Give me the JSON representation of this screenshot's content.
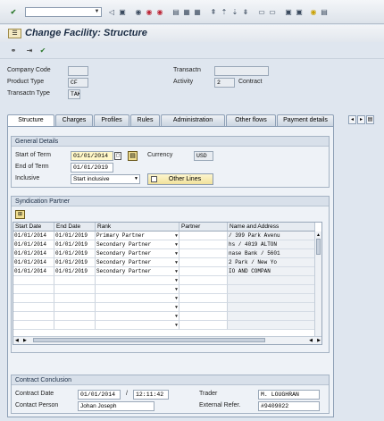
{
  "toolbar": {
    "enter_icon": "check-icon",
    "command_value": ""
  },
  "title": "Change Facility: Structure",
  "header": {
    "company_code_label": "Company Code",
    "company_code_value": "",
    "product_type_label": "Product Type",
    "product_type_value": "CF",
    "transactn_type_label": "Transactn Type",
    "transactn_type_value": "TAK",
    "transactn_label": "Transactn",
    "transactn_value": "",
    "activity_label": "Activity",
    "activity_value": "2",
    "activity_text": "Contract"
  },
  "tabs": [
    {
      "label": "Structure",
      "active": true
    },
    {
      "label": "Charges",
      "active": false
    },
    {
      "label": "Profiles",
      "active": false
    },
    {
      "label": "Rules",
      "active": false
    },
    {
      "label": "Administration",
      "active": false
    },
    {
      "label": "Other flows",
      "active": false
    },
    {
      "label": "Payment details",
      "active": false
    }
  ],
  "general": {
    "title": "General Details",
    "start_of_term_label": "Start of Term",
    "start_of_term_value": "01/01/2014",
    "end_of_term_label": "End of Term",
    "end_of_term_value": "01/01/2019",
    "inclusive_label": "Inclusive",
    "inclusive_value": "Start inclusive",
    "currency_label": "Currency",
    "currency_value": "USD",
    "other_lines_label": "Other Lines"
  },
  "syndication": {
    "title": "Syndication Partner",
    "columns": [
      "Start Date",
      "End Date",
      "Rank",
      "Partner",
      "Name and Address"
    ],
    "rows": [
      {
        "start": "01/01/2014",
        "end": "01/01/2019",
        "rank": "Primary Partner",
        "partner": "",
        "name": "/ 399 Park Avenu"
      },
      {
        "start": "01/01/2014",
        "end": "01/01/2019",
        "rank": "Secondary Partner",
        "partner": "",
        "name": "hs / 4019 ALTON"
      },
      {
        "start": "01/01/2014",
        "end": "01/01/2019",
        "rank": "Secondary Partner",
        "partner": "",
        "name": "nase Bank / 5601"
      },
      {
        "start": "01/01/2014",
        "end": "01/01/2019",
        "rank": "Secondary Partner",
        "partner": "",
        "name": "2 Park / New Yo"
      },
      {
        "start": "01/01/2014",
        "end": "01/01/2019",
        "rank": "Secondary Partner",
        "partner": "",
        "name": "IO AND COMPAN"
      }
    ]
  },
  "conclusion": {
    "title": "Contract Conclusion",
    "contract_date_label": "Contract Date",
    "contract_date_value": "01/01/2014",
    "separator": "/",
    "contract_time_value": "12:11:42",
    "trader_label": "Trader",
    "trader_value": "M. LOUGHRAN",
    "contact_person_label": "Contact Person",
    "contact_person_value": "Johan Joseph",
    "external_ref_label": "External Refer.",
    "external_ref_value": "#9409022"
  }
}
